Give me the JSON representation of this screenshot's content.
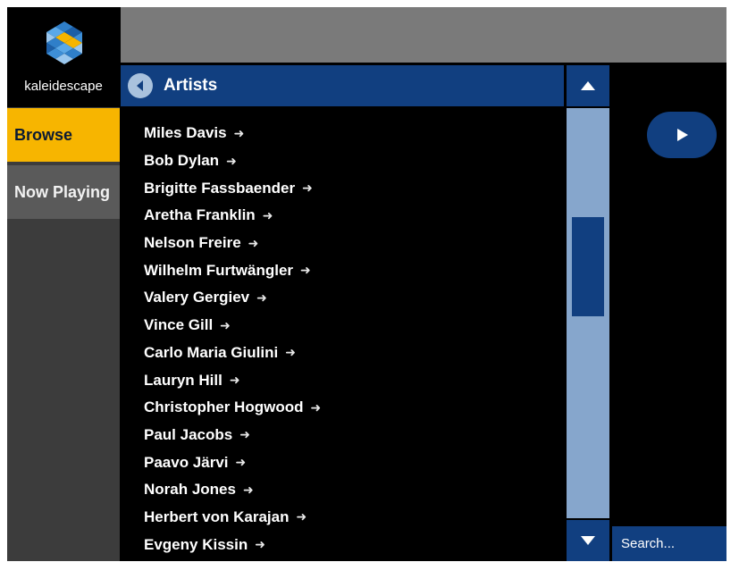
{
  "brand": {
    "name": "kaleidescape"
  },
  "nav": {
    "browse": "Browse",
    "now_playing": "Now Playing"
  },
  "header": {
    "title": "Artists",
    "back_icon": "back-arrow-icon"
  },
  "artists": [
    "Miles Davis",
    "Bob Dylan",
    "Brigitte Fassbaender",
    "Aretha Franklin",
    "Nelson Freire",
    "Wilhelm Furtwängler",
    "Valery Gergiev",
    "Vince Gill",
    "Carlo Maria Giulini",
    "Lauryn Hill",
    "Christopher Hogwood",
    "Paul Jacobs",
    "Paavo Järvi",
    "Norah Jones",
    "Herbert von Karajan",
    "Evgeny Kissin"
  ],
  "search": {
    "label": "Search..."
  },
  "colors": {
    "accent_blue": "#113f80",
    "browse_yellow": "#f7b500",
    "scroll_track": "#86a6cc",
    "sidebar_gray": "#3c3c3c"
  }
}
